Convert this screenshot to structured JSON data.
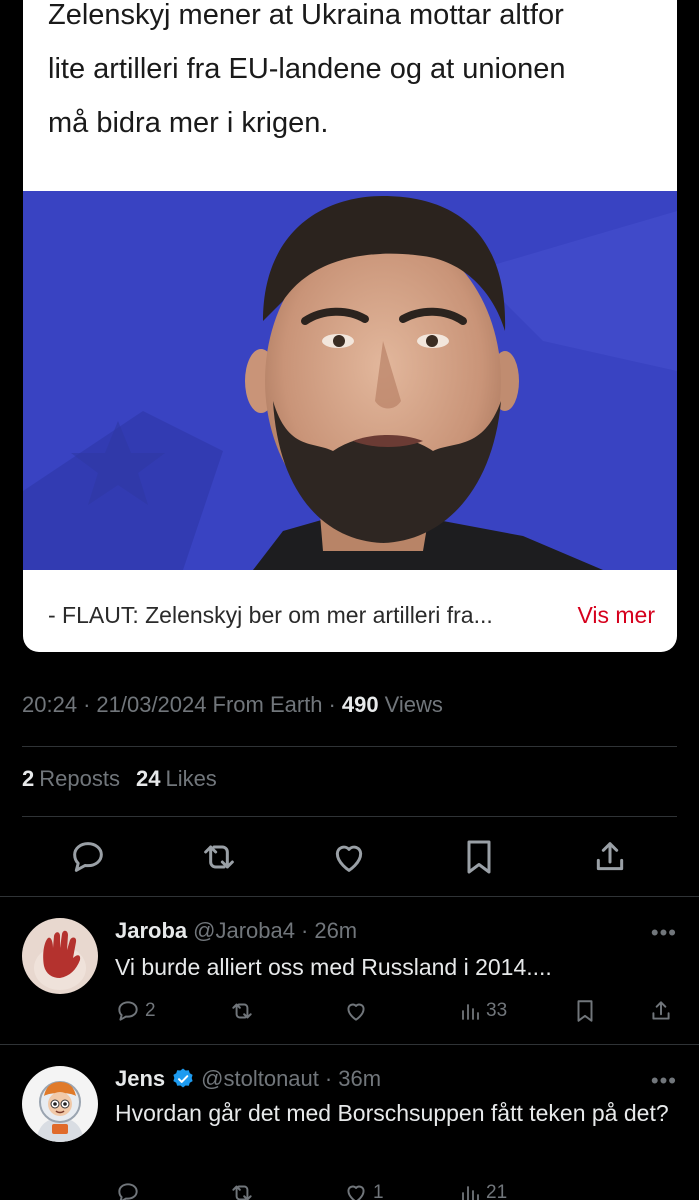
{
  "card": {
    "description_lines": [
      "Zelenskyj mener at Ukraina mottar altfor",
      "lite artilleri fra EU-landene og at unionen",
      "må bidra mer i krigen."
    ],
    "headline": "- FLAUT: Zelenskyj ber om mer artilleri fra...",
    "more_label": "Vis mer",
    "more_color": "#d6001c"
  },
  "meta": {
    "time": "20:24",
    "sep1": "·",
    "date": "21/03/2024",
    "source": "From Earth",
    "sep2": "·",
    "views_count": "490",
    "views_label": "Views"
  },
  "stats": {
    "reposts_count": "2",
    "reposts_label": "Reposts",
    "likes_count": "24",
    "likes_label": "Likes"
  },
  "actions": [
    {
      "icon": "reply-icon"
    },
    {
      "icon": "repost-icon"
    },
    {
      "icon": "like-icon"
    },
    {
      "icon": "bookmark-icon"
    },
    {
      "icon": "share-icon"
    }
  ],
  "replies": [
    {
      "name": "Jaroba",
      "verified": false,
      "handle": "@Jaroba4",
      "sep": "·",
      "time": "26m",
      "text": "Vi burde alliert oss med Russland i 2014....",
      "reply_count": "2",
      "repost_count": "",
      "like_count": "",
      "view_count": "33"
    },
    {
      "name": "Jens",
      "verified": true,
      "handle": "@stoltonaut",
      "sep": "·",
      "time": "36m",
      "text": "Hvordan går det med Borschsuppen fått teken på det?",
      "reply_count": "",
      "repost_count": "",
      "like_count": "1",
      "view_count": "21"
    }
  ],
  "more_dots": "•••",
  "colors": {
    "background": "#000000",
    "muted": "#71767b",
    "text": "#e7e9ea",
    "divider": "#2f3336",
    "verified": "#1d9bf0"
  }
}
